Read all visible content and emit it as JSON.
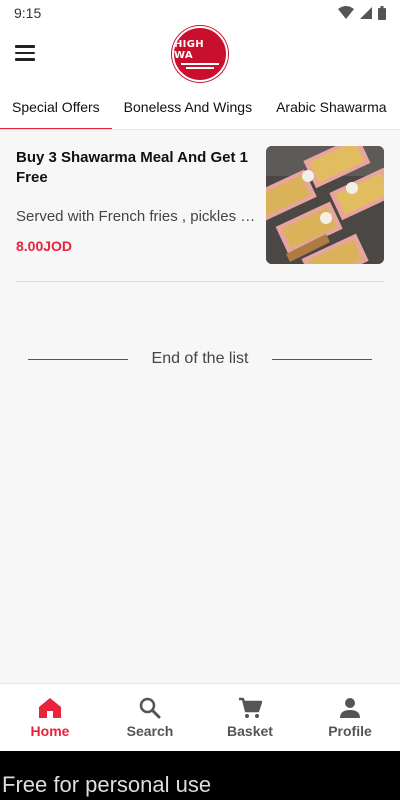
{
  "status_bar": {
    "time": "9:15"
  },
  "header": {
    "logo_text": "HIGH WA"
  },
  "tabs": [
    {
      "label": "Special Offers"
    },
    {
      "label": "Boneless And Wings"
    },
    {
      "label": "Arabic Shawarma"
    }
  ],
  "items": [
    {
      "title": "Buy 3 Shawarma Meal And Get 1 Free",
      "description": "Served with French fries , pickles and garlic",
      "price": "8.00JOD"
    }
  ],
  "end_of_list": "End of the list",
  "bottom_nav": [
    {
      "label": "Home"
    },
    {
      "label": "Search"
    },
    {
      "label": "Basket"
    },
    {
      "label": "Profile"
    }
  ],
  "watermark": "Free for personal use",
  "colors": {
    "accent": "#e8233a",
    "logo": "#c8102e"
  }
}
